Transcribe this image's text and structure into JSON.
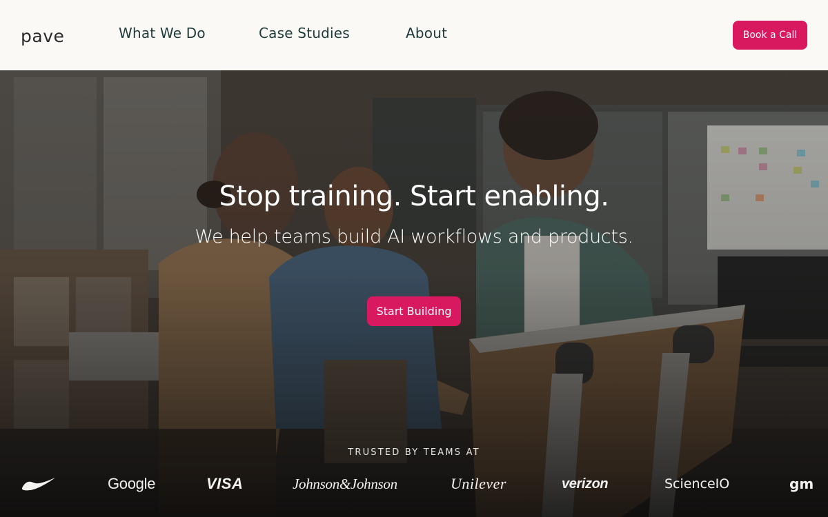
{
  "header": {
    "logo_text": "pave",
    "nav": [
      "What We Do",
      "Case Studies",
      "About"
    ],
    "cta_label": "Book a Call"
  },
  "hero": {
    "title": "Stop training. Start enabling.",
    "subtitle": "We help teams build AI workflows and products.",
    "cta_label": "Start Building",
    "trusted_label": "TRUSTED BY TEAMS AT",
    "brands": [
      "Google",
      "VISA",
      "Johnson&Johnson",
      "Unilever",
      "verizon",
      "ScienceIO",
      "gm"
    ]
  },
  "colors": {
    "accent": "#d8185f",
    "nav_text": "#1e3a3a",
    "header_bg": "#fbf9f6"
  },
  "icons": {
    "brand_nike": "nike-swoosh-icon"
  }
}
